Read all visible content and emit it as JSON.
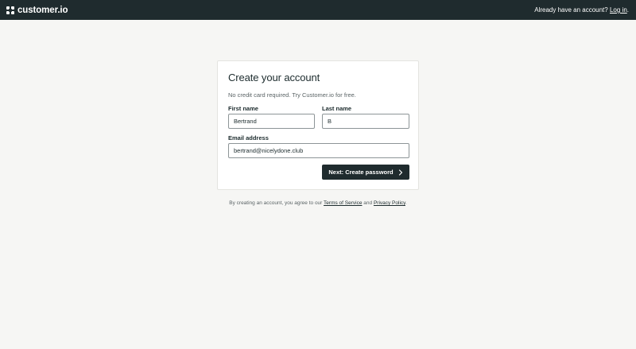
{
  "header": {
    "brand_name": "customer.io",
    "login_prompt": "Already have an account?",
    "login_link": "Log in",
    "login_suffix": "."
  },
  "form": {
    "title": "Create your account",
    "subtitle": "No credit card required. Try Customer.io for free.",
    "first_name": {
      "label": "First name",
      "value": "Bertrand"
    },
    "last_name": {
      "label": "Last name",
      "value": "B"
    },
    "email": {
      "label": "Email address",
      "value": "bertrand@nicelydone.club"
    },
    "submit_label": "Next: Create password"
  },
  "legal": {
    "prefix": "By creating an account, you agree to our",
    "terms_link": "Terms of Service",
    "and": "and",
    "privacy_link": "Privacy Policy",
    "suffix": "."
  },
  "colors": {
    "header_bg": "#1f2b2e",
    "page_bg": "#f6f6f4",
    "button_bg": "#1f2b2e"
  }
}
